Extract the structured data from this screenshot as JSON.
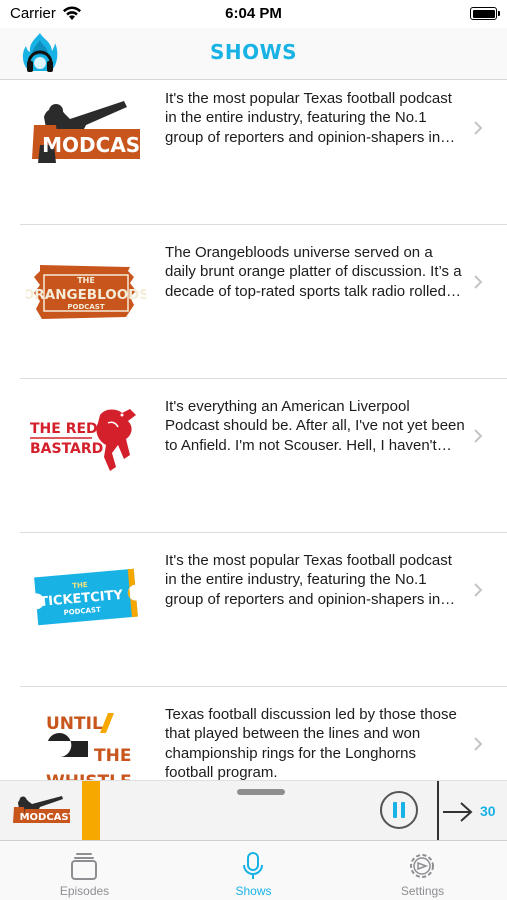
{
  "status_bar": {
    "carrier": "Carrier",
    "time": "6:04 PM"
  },
  "nav": {
    "title": "SHOWS",
    "logo_icon": "flame-headphones-icon"
  },
  "colors": {
    "accent": "#19b2e5",
    "progress": "#f6a700",
    "orange": "#c8551c",
    "red": "#d4202a"
  },
  "shows": [
    {
      "art": {
        "name": "modcast-logo",
        "text": "MODCAST"
      },
      "description": "It's the most popular Texas football podcast in the entire industry, featuring the No.1 group of reporters and opinion-shapers in the entire Universi…"
    },
    {
      "art": {
        "name": "orangebloods-podcast-logo",
        "top": "THE",
        "main": "ORANGEBLOODS",
        "sub": "PODCAST"
      },
      "description": "The Orangebloods universe served on a daily brunt orange platter of discussion. It’s a decade of top-rated sports talk radio rolled into a one hour…"
    },
    {
      "art": {
        "name": "the-red-bastard-logo",
        "line1": "THE RED",
        "line2": "BASTARD"
      },
      "description": "It's everything an American Liverpool Podcast should be. After all, I've not yet been to Anfield. I'm not Scouser. Hell, I haven't even been a Reds supp…"
    },
    {
      "art": {
        "name": "ticketcity-podcast-logo",
        "top": "THE",
        "main": "TICKETCITY",
        "sub": "PODCAST"
      },
      "description": "It's the most popular Texas football podcast in the entire industry, featuring the No.1 group of reporters and opinion-shapers in the entire Universi…"
    },
    {
      "art": {
        "name": "until-the-whistle-logo",
        "line1": "UNTIL",
        "line2": "THE",
        "line3": "WHISTLE"
      },
      "description": "Texas football discussion led by those those that played between the lines and won championship rings for the Longhorns football program."
    }
  ],
  "mini_player": {
    "art_text": "MODCAST",
    "skip_label": "30"
  },
  "tabs": [
    {
      "label": "Episodes",
      "icon": "episodes-stack-icon",
      "active": false
    },
    {
      "label": "Shows",
      "icon": "microphone-icon",
      "active": true
    },
    {
      "label": "Settings",
      "icon": "gear-icon",
      "active": false
    }
  ]
}
